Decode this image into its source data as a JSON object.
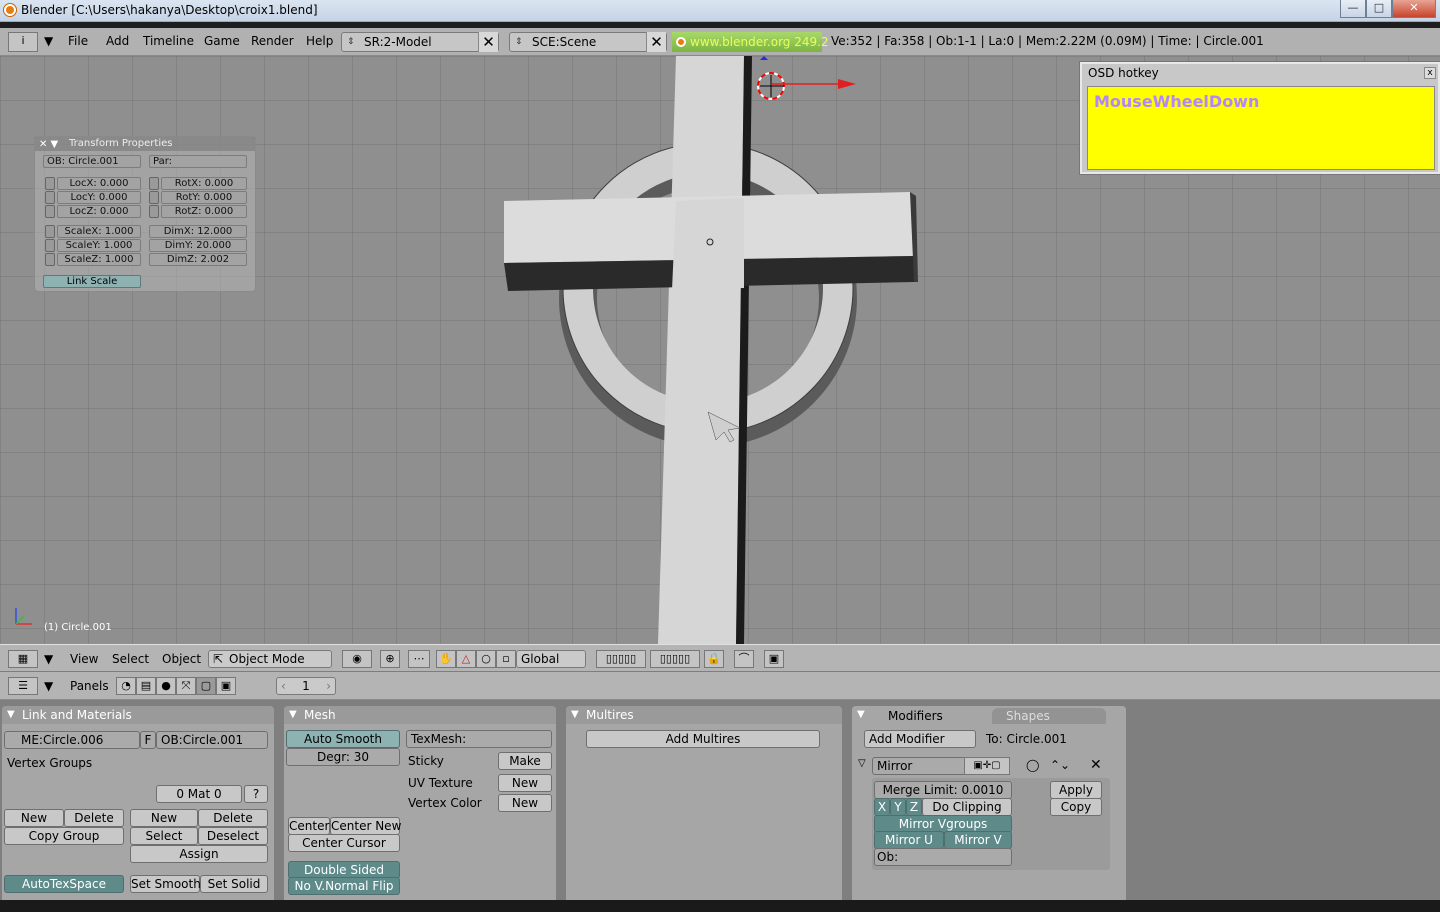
{
  "window": {
    "title": "Blender [C:\\Users\\hakanya\\Desktop\\croix1.blend]",
    "minimize": "—",
    "maximize": "□",
    "close": "✕"
  },
  "info": {
    "menu": [
      "File",
      "Add",
      "Timeline",
      "Game",
      "Render",
      "Help"
    ],
    "screen": "SR:2-Model",
    "scene": "SCE:Scene",
    "link": "www.blender.org 249.2",
    "stats": "Ve:352 | Fa:358 | Ob:1-1 | La:0  | Mem:2.22M (0.09M)  | Time: | Circle.001"
  },
  "transform": {
    "title": "Transform Properties",
    "ob": "OB: Circle.001",
    "par": "Par:",
    "locx": "LocX: 0.000",
    "locy": "LocY: 0.000",
    "locz": "LocZ: 0.000",
    "rotx": "RotX: 0.000",
    "roty": "RotY: 0.000",
    "rotz": "RotZ: 0.000",
    "scalex": "ScaleX: 1.000",
    "scaley": "ScaleY: 1.000",
    "scalez": "ScaleZ: 1.000",
    "dimx": "DimX: 12.000",
    "dimy": "DimY: 20.000",
    "dimz": "DimZ: 2.002",
    "link_scale": "Link Scale"
  },
  "osd": {
    "title": "OSD hotkey",
    "text": "MouseWheelDown",
    "close": "x"
  },
  "viewport": {
    "object_label": "(1) Circle.001"
  },
  "view_header": {
    "menus": [
      "View",
      "Select",
      "Object"
    ],
    "mode": "Object Mode",
    "orientation": "Global"
  },
  "buttons_header": {
    "panels_label": "Panels",
    "frame": "1"
  },
  "link_materials": {
    "title": "Link and Materials",
    "me": "ME:Circle.006",
    "f": "F",
    "ob": "OB:Circle.001",
    "vertex_groups": "Vertex Groups",
    "mat": "0 Mat 0",
    "question": "?",
    "new1": "New",
    "delete1": "Delete",
    "copy_group": "Copy Group",
    "new2": "New",
    "delete2": "Delete",
    "select": "Select",
    "deselect": "Deselect",
    "assign": "Assign",
    "autotexspace": "AutoTexSpace",
    "set_smooth": "Set Smooth",
    "set_solid": "Set Solid"
  },
  "mesh": {
    "title": "Mesh",
    "auto_smooth": "Auto Smooth",
    "degr": "Degr: 30",
    "texmesh": "TexMesh:",
    "sticky": "Sticky",
    "make": "Make",
    "uv_texture": "UV Texture",
    "new_uv": "New",
    "vertex_color": "Vertex Color",
    "new_vc": "New",
    "center": "Center",
    "center_new": "Center New",
    "center_cursor": "Center Cursor",
    "double_sided": "Double Sided",
    "no_vnormal_flip": "No V.Normal Flip"
  },
  "multires": {
    "title": "Multires",
    "add": "Add Multires"
  },
  "modifiers": {
    "tab_modifiers": "Modifiers",
    "tab_shapes": "Shapes",
    "add_modifier": "Add Modifier",
    "to": "To: Circle.001",
    "mirror": "Mirror",
    "merge_limit": "Merge Limit: 0.0010",
    "x": "X",
    "y": "Y",
    "z": "Z",
    "do_clipping": "Do Clipping",
    "mirror_vgroups": "Mirror Vgroups",
    "mirror_u": "Mirror U",
    "mirror_v": "Mirror V",
    "ob": "Ob:",
    "apply": "Apply",
    "copy": "Copy"
  }
}
